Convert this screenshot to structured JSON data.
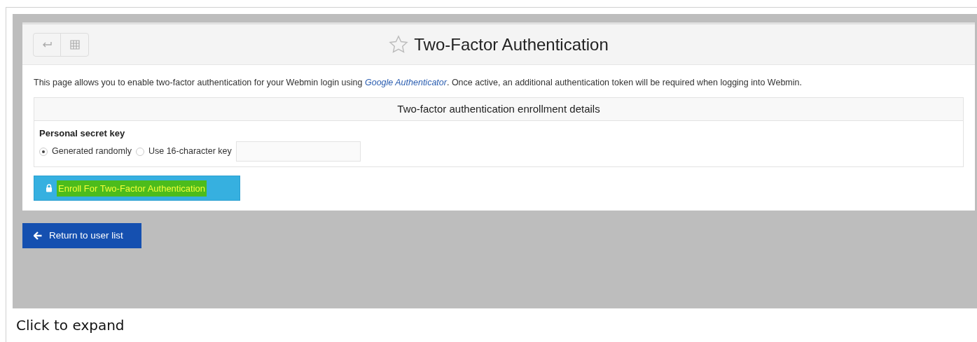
{
  "page": {
    "title": "Two-Factor Authentication",
    "starred": false,
    "intro": "This page allows you to enable two-factor authentication for your Webmin login using *Google Authenticator*. Once active, an additional authentication token will be required when logging into Webmin.",
    "table_title": "Two-factor authentication enrollment details",
    "field_label": "Personal secret key",
    "options": [
      {
        "label": "Generated randomly",
        "selected": true
      },
      {
        "label": "Use 16-character key",
        "selected": false
      }
    ],
    "enroll_button": {
      "label": "Enroll For Two-Factor Authentication",
      "highlighted": true
    },
    "return_button": {
      "label": "Return to user list"
    }
  },
  "caption": "Click to expand"
}
